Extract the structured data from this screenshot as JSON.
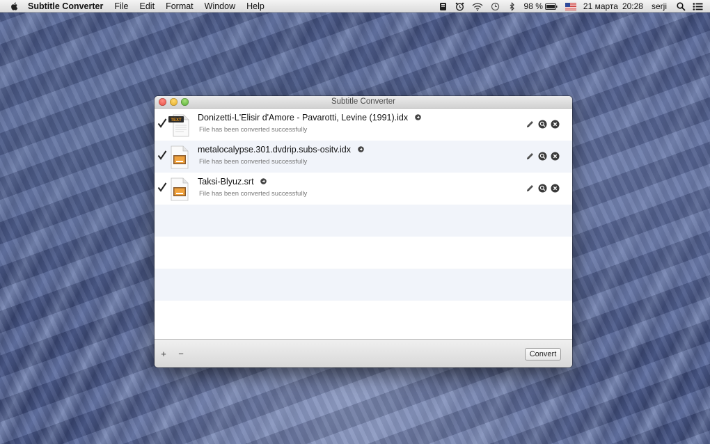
{
  "menubar": {
    "app_name": "Subtitle Converter",
    "menus": [
      "File",
      "Edit",
      "Format",
      "Window",
      "Help"
    ],
    "battery": "98 %",
    "date": "21 марта",
    "time": "20:28",
    "user": "serji"
  },
  "window": {
    "title": "Subtitle Converter",
    "files": [
      {
        "name": "Donizetti-L'Elisir d'Amore - Pavarotti, Levine (1991).idx",
        "status": "File has been converted successfully",
        "icon": "text-file-icon",
        "icon_badge": "TEXT"
      },
      {
        "name": "metalocalypse.301.dvdrip.subs-ositv.idx",
        "status": "File has been converted successfully",
        "icon": "subtitle-file-icon"
      },
      {
        "name": "Taksi-Blyuz.srt",
        "status": "File has been converted successfully",
        "icon": "subtitle-file-icon"
      }
    ],
    "add_label": "+",
    "remove_label": "−",
    "convert_label": "Convert"
  },
  "colors": {
    "row_alt": "#f1f4fa",
    "close": "#e2463c",
    "minimize": "#e0a521",
    "maximize": "#4fa72e"
  }
}
